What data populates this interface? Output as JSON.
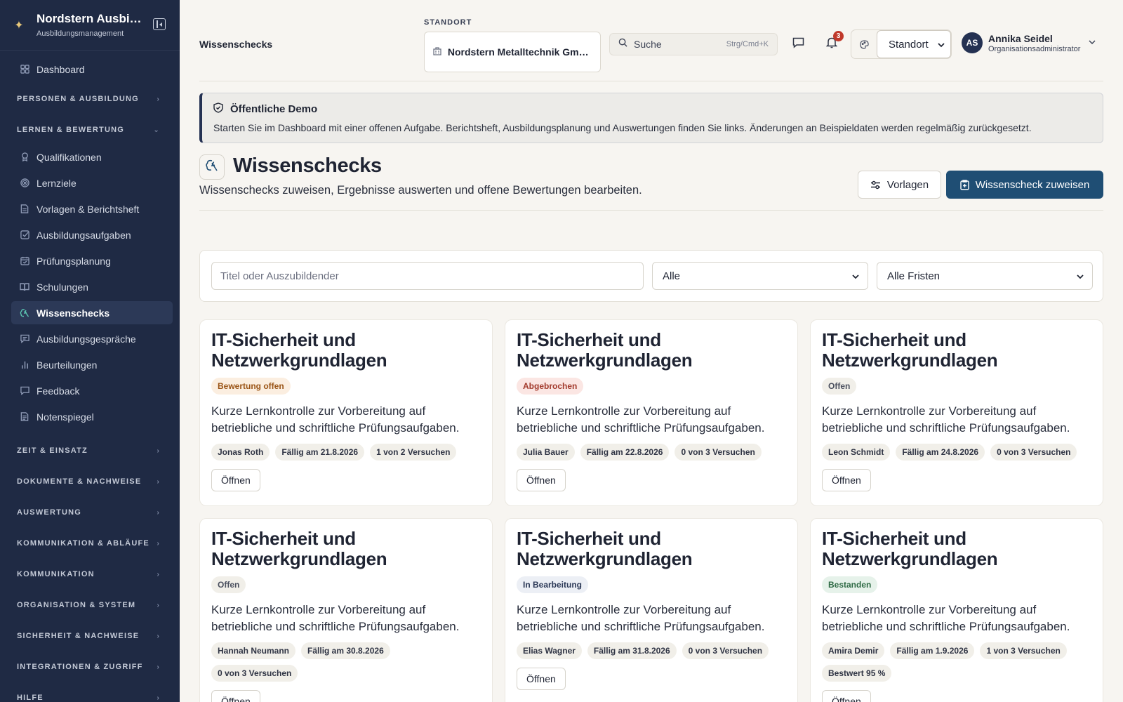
{
  "app": {
    "name": "Nordstern Ausbil...",
    "subtitle": "Ausbildungsmanagement"
  },
  "sidebar": {
    "top_item": {
      "label": "Dashboard",
      "icon": "dashboard-icon"
    },
    "sections": [
      {
        "label": "PERSONEN & AUSBILDUNG",
        "expanded": false
      },
      {
        "label": "LERNEN & BEWERTUNG",
        "expanded": true
      }
    ],
    "items": [
      {
        "label": "Qualifikationen",
        "icon": "award-icon"
      },
      {
        "label": "Lernziele",
        "icon": "target-icon"
      },
      {
        "label": "Vorlagen & Berichtsheft",
        "icon": "document-icon"
      },
      {
        "label": "Ausbildungsaufgaben",
        "icon": "checkbox-icon"
      },
      {
        "label": "Prüfungsplanung",
        "icon": "calendar-icon"
      },
      {
        "label": "Schulungen",
        "icon": "book-icon"
      },
      {
        "label": "Wissenschecks",
        "icon": "brain-icon",
        "active": true
      },
      {
        "label": "Ausbildungsgespräche",
        "icon": "message-icon"
      },
      {
        "label": "Beurteilungen",
        "icon": "bar-chart-icon"
      },
      {
        "label": "Feedback",
        "icon": "chat-icon"
      },
      {
        "label": "Notenspiegel",
        "icon": "list-icon"
      }
    ],
    "more_sections": [
      "ZEIT & EINSATZ",
      "DOKUMENTE & NACHWEISE",
      "AUSWERTUNG",
      "KOMMUNIKATION & ABLÄUFE",
      "KOMMUNIKATION",
      "ORGANISATION & SYSTEM",
      "SICHERHEIT & NACHWEISE",
      "INTEGRATIONEN & ZUGRIFF",
      "HILFE"
    ]
  },
  "topbar": {
    "page": "Wissenschecks",
    "standort_label": "STANDORT",
    "standort_value": "Nordstern Metalltechnik Gmb...",
    "search_placeholder": "Suche",
    "search_shortcut": "Strg/Cmd+K",
    "notification_count": "3",
    "theme_select_value": "Standort",
    "user_initials": "AS",
    "user_name": "Annika Seidel",
    "user_role": "Organisationsadministrator"
  },
  "demo": {
    "title": "Öffentliche Demo",
    "text": "Starten Sie im Dashboard mit einer offenen Aufgabe. Berichtsheft, Ausbildungsplanung und Auswertungen finden Sie links. Änderungen an Beispieldaten werden regelmäßig zurückgesetzt."
  },
  "header": {
    "title": "Wissenschecks",
    "subtitle": "Wissenschecks zuweisen, Ergebnisse auswerten und offene Bewertungen bearbeiten.",
    "templates_button": "Vorlagen",
    "assign_button": "Wissenscheck zuweisen"
  },
  "filters": {
    "search_placeholder": "Titel oder Auszubildender",
    "status_value": "Alle",
    "deadline_value": "Alle Fristen"
  },
  "cards": [
    {
      "title": "IT-Sicherheit und Netzwerkgrundlagen",
      "status": "Bewertung offen",
      "status_kind": "review",
      "description": "Kurze Lernkontrolle zur Vorbereitung auf betriebliche und schriftliche Prüfungsaufgaben.",
      "chips": [
        "Jonas Roth",
        "Fällig am 21.8.2026",
        "1 von 2 Versuchen"
      ],
      "action": "Öffnen"
    },
    {
      "title": "IT-Sicherheit und Netzwerkgrundlagen",
      "status": "Abgebrochen",
      "status_kind": "aborted",
      "description": "Kurze Lernkontrolle zur Vorbereitung auf betriebliche und schriftliche Prüfungsaufgaben.",
      "chips": [
        "Julia Bauer",
        "Fällig am 22.8.2026",
        "0 von 3 Versuchen"
      ],
      "action": "Öffnen"
    },
    {
      "title": "IT-Sicherheit und Netzwerkgrundlagen",
      "status": "Offen",
      "status_kind": "open",
      "description": "Kurze Lernkontrolle zur Vorbereitung auf betriebliche und schriftliche Prüfungsaufgaben.",
      "chips": [
        "Leon Schmidt",
        "Fällig am 24.8.2026",
        "0 von 3 Versuchen"
      ],
      "action": "Öffnen"
    },
    {
      "title": "IT-Sicherheit und Netzwerkgrundlagen",
      "status": "Offen",
      "status_kind": "open",
      "description": "Kurze Lernkontrolle zur Vorbereitung auf betriebliche und schriftliche Prüfungsaufgaben.",
      "chips": [
        "Hannah Neumann",
        "Fällig am 30.8.2026",
        "0 von 3 Versuchen"
      ],
      "action": "Öffnen"
    },
    {
      "title": "IT-Sicherheit und Netzwerkgrundlagen",
      "status": "In Bearbeitung",
      "status_kind": "progress",
      "description": "Kurze Lernkontrolle zur Vorbereitung auf betriebliche und schriftliche Prüfungsaufgaben.",
      "chips": [
        "Elias Wagner",
        "Fällig am 31.8.2026",
        "0 von 3 Versuchen"
      ],
      "action": "Öffnen"
    },
    {
      "title": "IT-Sicherheit und Netzwerkgrundlagen",
      "status": "Bestanden",
      "status_kind": "passed",
      "description": "Kurze Lernkontrolle zur Vorbereitung auf betriebliche und schriftliche Prüfungsaufgaben.",
      "chips": [
        "Amira Demir",
        "Fällig am 1.9.2026",
        "1 von 3 Versuchen",
        "Bestwert 95 %"
      ],
      "action": "Öffnen"
    }
  ],
  "colors": {
    "sidebar_bg": "#1f2a44",
    "primary": "#1f4e74",
    "status_review": "#fbeee0",
    "status_aborted": "#fbe6e3",
    "status_open": "#f1efe9",
    "status_progress": "#eceff5",
    "status_passed": "#e6f2ea"
  }
}
